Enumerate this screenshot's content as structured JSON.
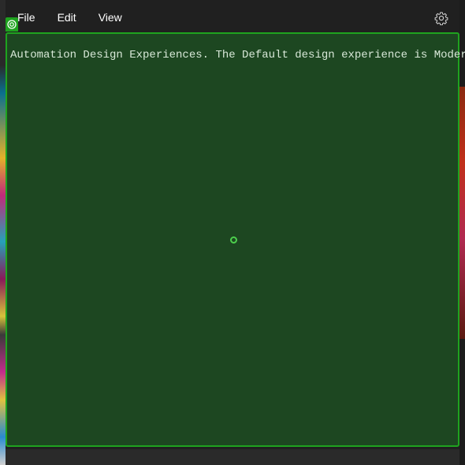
{
  "menubar": {
    "items": [
      {
        "label": "File"
      },
      {
        "label": "Edit"
      },
      {
        "label": "View"
      }
    ],
    "settings_icon": "gear-icon"
  },
  "panel": {
    "text": "Automation Design Experiences. The Default design experience is Modern.",
    "badge_icon": "target-icon",
    "background_color": "#1d4721",
    "border_color": "#1fa31f"
  }
}
